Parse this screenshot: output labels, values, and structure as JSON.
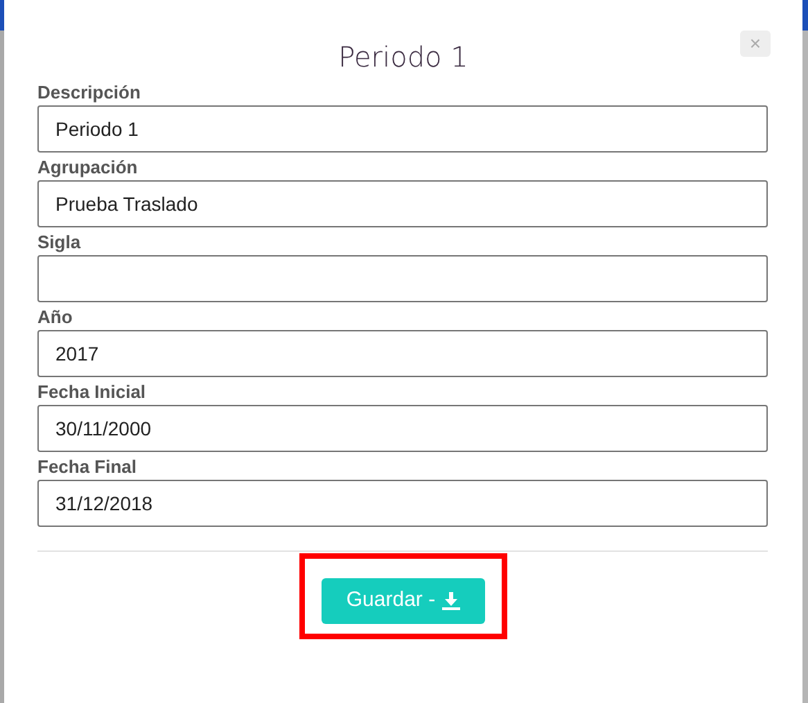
{
  "dialog": {
    "title": "Periodo 1",
    "close_label": "×"
  },
  "fields": [
    {
      "label": "Descripción",
      "value": "Periodo 1"
    },
    {
      "label": "Agrupación",
      "value": "Prueba Traslado"
    },
    {
      "label": "Sigla"
    },
    {
      "label": "Año",
      "value": "2017"
    },
    {
      "label": "Fecha Inicial",
      "value": "30/11/2000"
    },
    {
      "label": "Fecha Final",
      "value": "31/12/2018"
    }
  ],
  "save_button": {
    "label": "Guardar -",
    "highlighted": true
  }
}
